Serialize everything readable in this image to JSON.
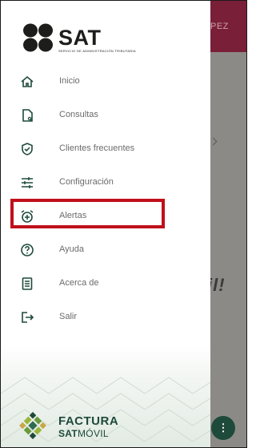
{
  "app": {
    "header_partial": "PEZ",
    "background_text": "il!"
  },
  "logo": {
    "word": "SAT",
    "subtitle": "SERVICIO DE ADMINISTRACIÓN TRIBUTARIA"
  },
  "menu": {
    "items": [
      {
        "label": "Inicio",
        "icon": "home-icon"
      },
      {
        "label": "Consultas",
        "icon": "document-search-icon"
      },
      {
        "label": "Clientes frecuentes",
        "icon": "shield-check-icon"
      },
      {
        "label": "Configuración",
        "icon": "sliders-icon"
      },
      {
        "label": "Alertas",
        "icon": "alarm-add-icon"
      },
      {
        "label": "Ayuda",
        "icon": "help-circle-icon"
      },
      {
        "label": "Acerca de",
        "icon": "info-document-icon"
      },
      {
        "label": "Salir",
        "icon": "logout-icon"
      }
    ],
    "highlighted_index": 4
  },
  "brand": {
    "line1": "FACTURA",
    "line2_bold": "SAT",
    "line2_rest": "MÓVIL"
  },
  "fab": {
    "label": "⋮"
  },
  "colors": {
    "accent_green": "#1e4a3c",
    "highlight_red": "#c0101b",
    "header_maroon": "#7a1f38",
    "icon_green": "#1e4a3c"
  }
}
